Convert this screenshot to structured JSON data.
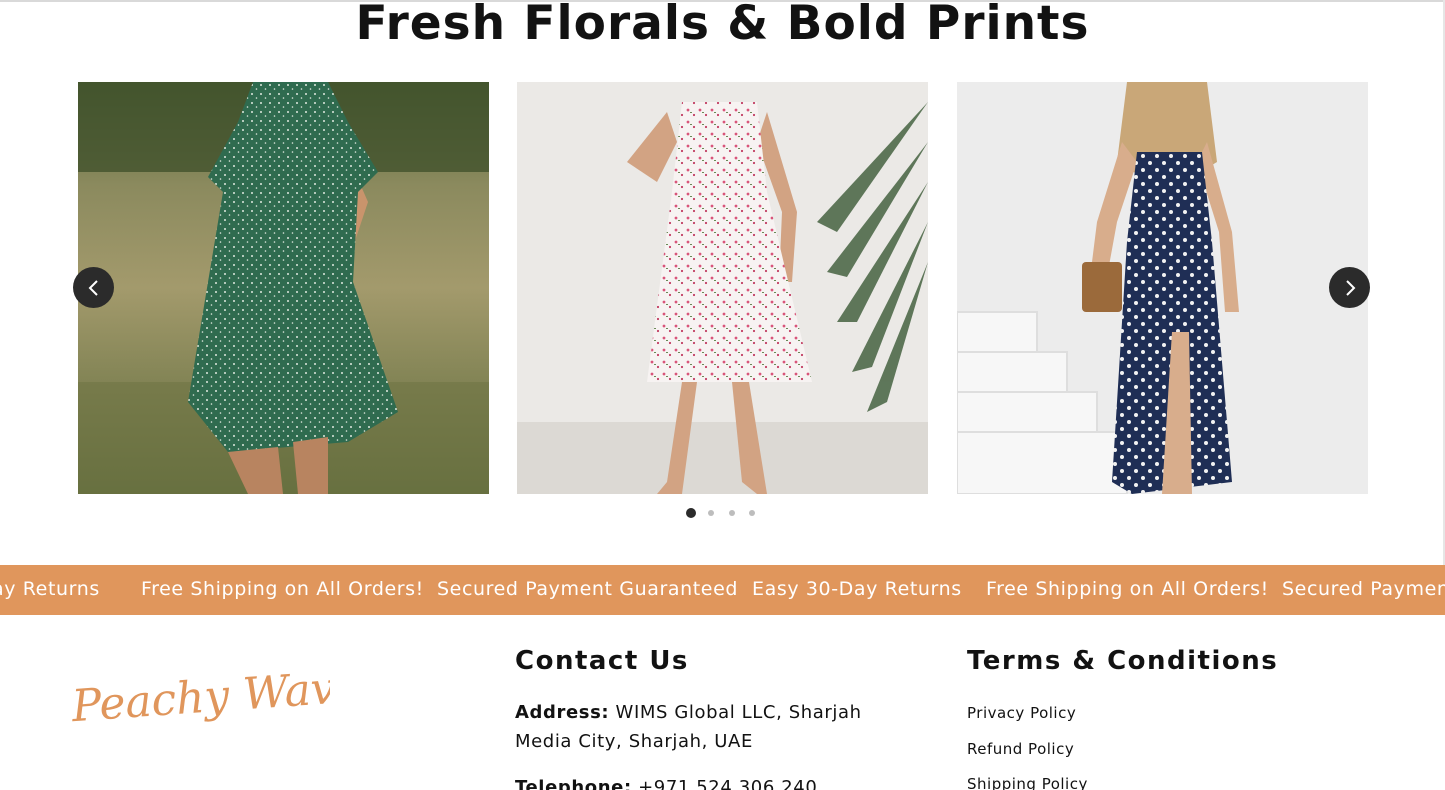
{
  "section": {
    "title": "Fresh Florals & Bold Prints"
  },
  "slider": {
    "slides": [
      {
        "name": "green-polka-dot-dress",
        "color": "#2f6b4f"
      },
      {
        "name": "white-floral-dress",
        "color": "#f4eeee"
      },
      {
        "name": "navy-polka-dot-dress",
        "color": "#1f2e55"
      }
    ],
    "prev_icon": "chevron-left-icon",
    "next_icon": "chevron-right-icon",
    "dots": [
      {
        "active": true
      },
      {
        "active": false
      },
      {
        "active": false
      },
      {
        "active": false
      }
    ]
  },
  "announcement": {
    "background": "#e0965c",
    "items": [
      "ay Returns",
      "Free Shipping on All Orders!",
      "Secured Payment Guaranteed",
      "Easy 30-Day Returns",
      "Free Shipping on All Orders!",
      "Secured Payment G"
    ]
  },
  "footer": {
    "logo_text": "Peachy Waves",
    "logo_color": "#e0965c",
    "contact": {
      "heading": "Contact Us",
      "address_label": "Address:",
      "address_value": "WIMS Global LLC, Sharjah Media City, Sharjah, UAE",
      "telephone_label": "Telephone:",
      "telephone_value": "+971 524 306 240"
    },
    "terms": {
      "heading": "Terms & Conditions",
      "links": [
        "Privacy Policy",
        "Refund Policy",
        "Shipping Policy"
      ]
    }
  }
}
